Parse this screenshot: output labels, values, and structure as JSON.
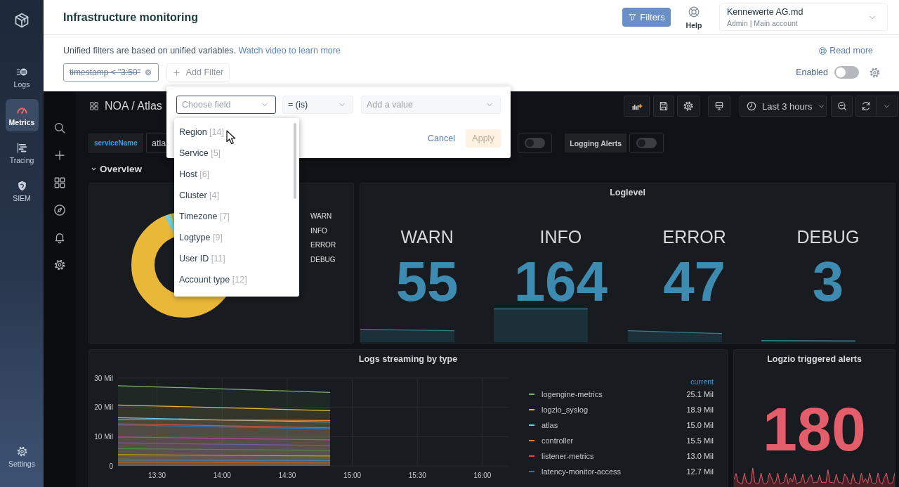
{
  "nav": {
    "items": [
      {
        "label": "Logs",
        "selected": false
      },
      {
        "label": "Metrics",
        "selected": true
      },
      {
        "label": "Tracing",
        "selected": false
      },
      {
        "label": "SIEM",
        "selected": false
      }
    ],
    "settings": {
      "label": "Settings"
    }
  },
  "header": {
    "title": "Infrastructure monitoring",
    "filters_button": "Filters",
    "help": "Help",
    "account": {
      "name": "Kennewerte AG.md",
      "details": "Admin | Main account"
    }
  },
  "filter_bar": {
    "intro": "Unified filters are based on unified variables.",
    "link": "Watch video to learn more",
    "read_more": "Read more",
    "chips": [
      {
        "label": "timestamp < \"3:50\"",
        "disabled": true
      }
    ],
    "add_filter": "Add Filter",
    "enabled": {
      "label": "Enabled",
      "on": false
    }
  },
  "filter_popup": {
    "field": {
      "placeholder": "Choose field",
      "open": true
    },
    "operator": {
      "value": "= (is)"
    },
    "value": {
      "placeholder": "Add a value"
    },
    "options": [
      {
        "label": "Region",
        "count": "[14]"
      },
      {
        "label": "Service",
        "count": "[5]"
      },
      {
        "label": "Host",
        "count": "[6]"
      },
      {
        "label": "Cluster",
        "count": "[4]"
      },
      {
        "label": "Timezone",
        "count": "[7]"
      },
      {
        "label": "Logtype",
        "count": "[9]"
      },
      {
        "label": "User ID",
        "count": "[11]"
      },
      {
        "label": "Account type",
        "count": "[12]"
      }
    ],
    "cancel": "Cancel",
    "apply": {
      "label": "Apply",
      "disabled": true
    }
  },
  "dashboard": {
    "title": "NOA / Atlas",
    "time_range": "Last 3 hours",
    "variables": [
      {
        "kind": "text",
        "label": "serviceName",
        "value": "atla"
      },
      {
        "kind": "toggle",
        "on": false
      },
      {
        "kind": "toggle",
        "label": "Logging Alerts",
        "on": false
      }
    ],
    "row": {
      "title": "Overview",
      "expanded": true
    },
    "panels": [
      {
        "kind": "pie",
        "legend": [
          "WARN",
          "INFO",
          "ERROR",
          "DEBUG"
        ]
      },
      {
        "kind": "stat_group",
        "title": "Loglevel",
        "stats": [
          {
            "label": "WARN",
            "value": "55"
          },
          {
            "label": "INFO",
            "value": "164"
          },
          {
            "label": "ERROR",
            "value": "47"
          },
          {
            "label": "DEBUG",
            "value": "3"
          }
        ]
      },
      {
        "kind": "timeseries",
        "title": "Logs streaming by type",
        "legend": {
          "header": "current",
          "values": [
            "25.1 Mil",
            "18.9 Mil",
            "15.0 Mil",
            "15.5 Mil",
            "13.0 Mil",
            "12.7 Mil"
          ]
        },
        "chart_data": [
          {
            "type": "area",
            "grid": true,
            "x": [
              13.2,
              14,
              14.83
            ],
            "xlim": [
              13.2,
              16.2
            ],
            "ylim": [
              0,
              30
            ],
            "xticks": [
              {
                "value": 13.5,
                "label": "13:30"
              },
              {
                "value": 14,
                "label": "14:00"
              },
              {
                "value": 14.5,
                "label": "14:30"
              },
              {
                "value": 15,
                "label": "15:00"
              },
              {
                "value": 15.5,
                "label": "15:30"
              },
              {
                "value": 16,
                "label": "16:00"
              }
            ],
            "yticks": [
              {
                "value": 0,
                "label": "0"
              },
              {
                "value": 10,
                "label": "10 Mil"
              },
              {
                "value": 20,
                "label": "20 Mil"
              },
              {
                "value": 30,
                "label": "30 Mil"
              }
            ],
            "series": [
              {
                "name": "logengine-metrics",
                "color": "#7eb26d",
                "values": [
                  27.4,
                  26.3,
                  25.1
                ]
              },
              {
                "name": "logzio_syslog",
                "color": "#eab839",
                "values": [
                  20.8,
                  19.9,
                  18.9
                ]
              },
              {
                "name": "atlas",
                "color": "#6ed0e0",
                "values": [
                  16.5,
                  15.7,
                  15.0
                ]
              },
              {
                "name": "controller",
                "color": "#ef843c",
                "values": [
                  15.9,
                  15.7,
                  15.5
                ]
              },
              {
                "name": "listener-metrics",
                "color": "#e24d42",
                "values": [
                  14.4,
                  13.7,
                  13.0
                ]
              },
              {
                "name": "latency-monitor-access",
                "color": "#1f78c1",
                "values": [
                  14.0,
                  13.3,
                  12.7
                ]
              },
              {
                "color": "#ba43a9",
                "values": [
                  9.9,
                  9.4,
                  8.9
                ]
              },
              {
                "color": "#705da0",
                "values": [
                  7.9,
                  7.4,
                  7.0
                ]
              },
              {
                "color": "#508642",
                "values": [
                  5.9,
                  5.6,
                  5.3
                ]
              },
              {
                "color": "#cca300",
                "values": [
                  3.9,
                  3.6,
                  3.4
                ]
              },
              {
                "color": "#447ebc",
                "values": [
                  2.0,
                  1.9,
                  1.8
                ]
              },
              {
                "color": "#c15c17",
                "values": [
                  1.2,
                  1.1,
                  1.0
                ]
              }
            ]
          }
        ]
      },
      {
        "kind": "stat",
        "title": "Logzio triggered alerts",
        "value": "180"
      }
    ]
  }
}
